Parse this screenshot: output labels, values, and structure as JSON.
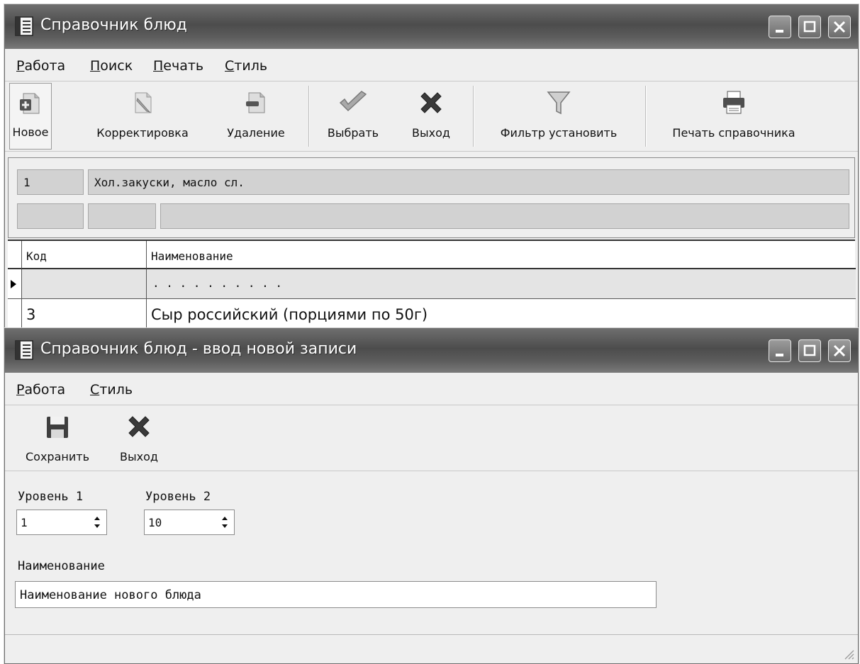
{
  "main_window": {
    "title": "Справочник блюд",
    "menu": [
      {
        "label": "Работа",
        "accel": "Р",
        "rest": "абота"
      },
      {
        "label": "Поиск",
        "accel": "П",
        "rest": "оиск"
      },
      {
        "label": "Печать",
        "accel": "П",
        "rest": "ечать"
      },
      {
        "label": "Стиль",
        "accel": "С",
        "rest": "тиль"
      }
    ],
    "toolbar": {
      "new_label": "Новое",
      "edit_label": "Корректировка",
      "delete_label": "Удаление",
      "select_label": "Выбрать",
      "exit_label": "Выход",
      "filter_label": "Фильтр установить",
      "print_label": "Печать справочника"
    },
    "filter": {
      "code": "1",
      "name": "Хол.закуски, масло сл.",
      "field3": "",
      "field4": "",
      "field5": ""
    },
    "grid": {
      "columns": [
        "Код",
        "Наименование"
      ],
      "rows": [
        {
          "code": "",
          "name": ". . . . . . . . . ."
        },
        {
          "code": "3",
          "name": "Сыр российский (порциями по 50г)"
        }
      ]
    }
  },
  "dialog": {
    "title": "Справочник блюд - ввод новой записи",
    "menu": [
      {
        "label": "Работа",
        "accel": "Р",
        "rest": "абота"
      },
      {
        "label": "Стиль",
        "accel": "С",
        "rest": "тиль"
      }
    ],
    "toolbar": {
      "save_label": "Сохранить",
      "exit_label": "Выход"
    },
    "level1": {
      "label": "Уровень 1",
      "value": "1"
    },
    "level2": {
      "label": "Уровень 2",
      "value": "10"
    },
    "name": {
      "label": "Наименование",
      "value": "Наименование нового блюда"
    }
  }
}
